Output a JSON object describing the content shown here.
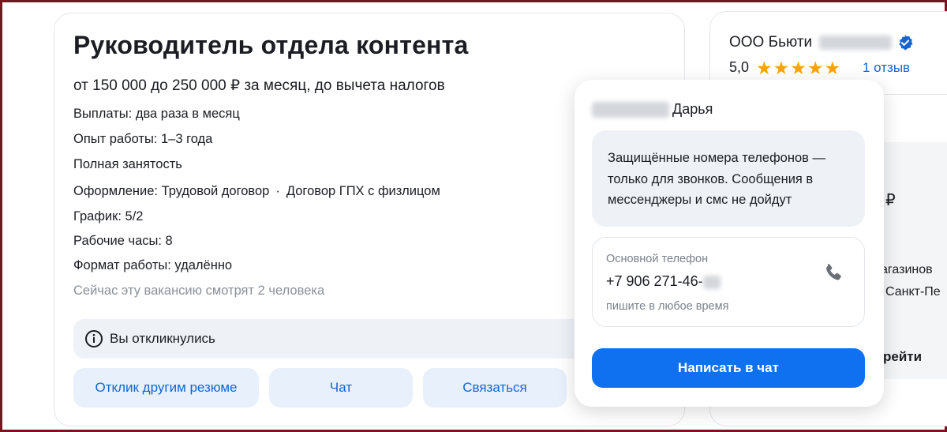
{
  "vacancy": {
    "title": "Руководитель отдела контента",
    "salary": "от 150 000 до 250 000 ₽ за месяц, до вычета налогов",
    "payments": "Выплаты: два раза в месяц",
    "experience": "Опыт работы: 1–3 года",
    "employment": "Полная занятость",
    "contract_prefix": "Оформление: Трудовой договор",
    "contract_separator": "·",
    "contract_second": "Договор ГПХ с физлицом",
    "schedule": "График: 5/2",
    "hours": "Рабочие часы: 8",
    "work_format": "Формат работы: удалённо",
    "viewers": "Сейчас эту вакансию смотрят 2 человека",
    "responded_label": "Вы откликнулись"
  },
  "actions": {
    "other_resume": "Отклик другим резюме",
    "chat": "Чат",
    "contact": "Связаться"
  },
  "employer": {
    "name": "ООО Бьюти",
    "rating": "5,0",
    "stars": "★★★★★",
    "reviews": "1 отзыв",
    "peek_currency": "₽",
    "peek_text_1": "агазинов",
    "peek_text_2": "Санкт-Пе",
    "peek_text_3": "рейти"
  },
  "contact_popup": {
    "contact_first_name": "Дарья",
    "notice": "Защищённые номера телефонов — только для звонков. Сообщения в мессенджеры и смс не дойдут",
    "phone_label": "Основной телефон",
    "phone_number": "+7 906 271-46-",
    "phone_hint": "пишите в любое время",
    "chat_button": "Написать в чат"
  },
  "colors": {
    "accent": "#0f70f0",
    "link": "#1664d0",
    "star": "#fba400",
    "frame": "#7a1420"
  },
  "icons": [
    "info-icon",
    "verified-icon",
    "phone-icon"
  ]
}
